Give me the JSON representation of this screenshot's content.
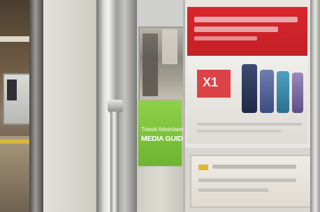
{
  "sign": {
    "subtitle": "Transit Advertisement",
    "title": "MEDIA GUIDE",
    "color": "#7cc23a"
  },
  "poster": {
    "accent_color": "#d8262c",
    "model_label": "X1"
  }
}
